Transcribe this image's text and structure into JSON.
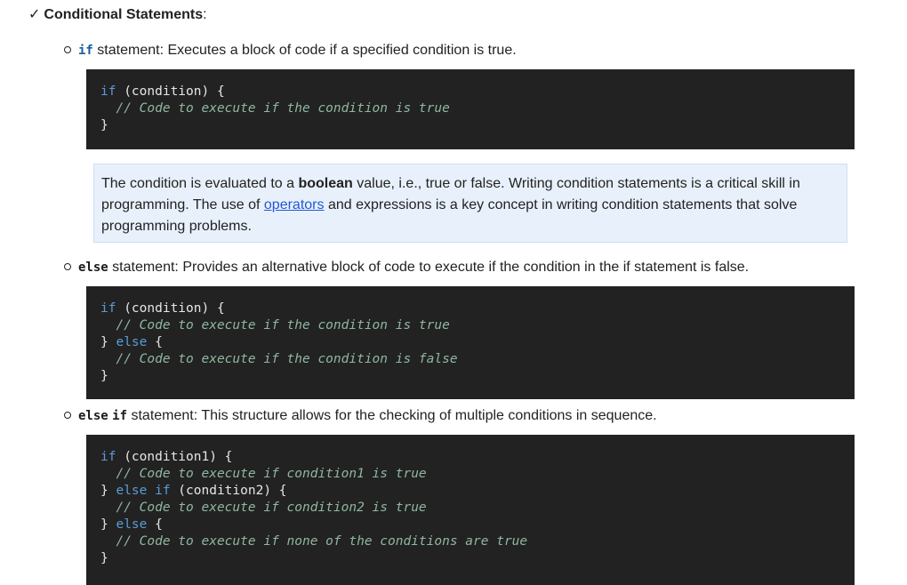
{
  "heading": {
    "check": "✓",
    "title": "Conditional Statements",
    "colon": ":"
  },
  "items": [
    {
      "keyword1": "if",
      "keyword2": "",
      "text": " statement: Executes a block of code if a specified condition is true."
    },
    {
      "keyword1": "else",
      "keyword2": "",
      "text": " statement: Provides an alternative block of code to execute if the condition in the if statement is false."
    },
    {
      "keyword1": "else",
      "keyword2": "if",
      "text": " statement: This structure allows for the checking of multiple conditions in sequence."
    }
  ],
  "code": {
    "block1": [
      [
        {
          "t": "kw",
          "v": "if"
        },
        {
          "t": "tx",
          "v": " (condition) {"
        }
      ],
      [
        {
          "t": "tx",
          "v": "  "
        },
        {
          "t": "cm",
          "v": "// Code to execute if the condition is true"
        }
      ],
      [
        {
          "t": "tx",
          "v": "}"
        }
      ]
    ],
    "block2": [
      [
        {
          "t": "kw",
          "v": "if"
        },
        {
          "t": "tx",
          "v": " (condition) {"
        }
      ],
      [
        {
          "t": "tx",
          "v": "  "
        },
        {
          "t": "cm",
          "v": "// Code to execute if the condition is true"
        }
      ],
      [
        {
          "t": "tx",
          "v": "} "
        },
        {
          "t": "kw",
          "v": "else"
        },
        {
          "t": "tx",
          "v": " {"
        }
      ],
      [
        {
          "t": "tx",
          "v": "  "
        },
        {
          "t": "cm",
          "v": "// Code to execute if the condition is false"
        }
      ],
      [
        {
          "t": "tx",
          "v": "}"
        }
      ]
    ],
    "block3": [
      [
        {
          "t": "kw",
          "v": "if"
        },
        {
          "t": "tx",
          "v": " (condition1) {"
        }
      ],
      [
        {
          "t": "tx",
          "v": "  "
        },
        {
          "t": "cm",
          "v": "// Code to execute if condition1 is true"
        }
      ],
      [
        {
          "t": "tx",
          "v": "} "
        },
        {
          "t": "kw",
          "v": "else if"
        },
        {
          "t": "tx",
          "v": " (condition2) {"
        }
      ],
      [
        {
          "t": "tx",
          "v": "  "
        },
        {
          "t": "cm",
          "v": "// Code to execute if condition2 is true"
        }
      ],
      [
        {
          "t": "tx",
          "v": "} "
        },
        {
          "t": "kw",
          "v": "else"
        },
        {
          "t": "tx",
          "v": " {"
        }
      ],
      [
        {
          "t": "tx",
          "v": "  "
        },
        {
          "t": "cm",
          "v": "// Code to execute if none of the conditions are true"
        }
      ],
      [
        {
          "t": "tx",
          "v": "}"
        }
      ]
    ]
  },
  "note": {
    "part1": "The condition is evaluated to a ",
    "bold": "boolean",
    "part2": " value, i.e., true or false. Writing condition statements is a critical skill in programming. The use of ",
    "link": "operators",
    "part3": " and expressions is a key concept in writing condition statements that solve programming problems."
  },
  "colors": {
    "code_bg": "#222222",
    "keyword": "#5b9bd8",
    "comment": "#8fb7a0",
    "note_bg": "#e8f1fb",
    "link": "#2457d6"
  }
}
